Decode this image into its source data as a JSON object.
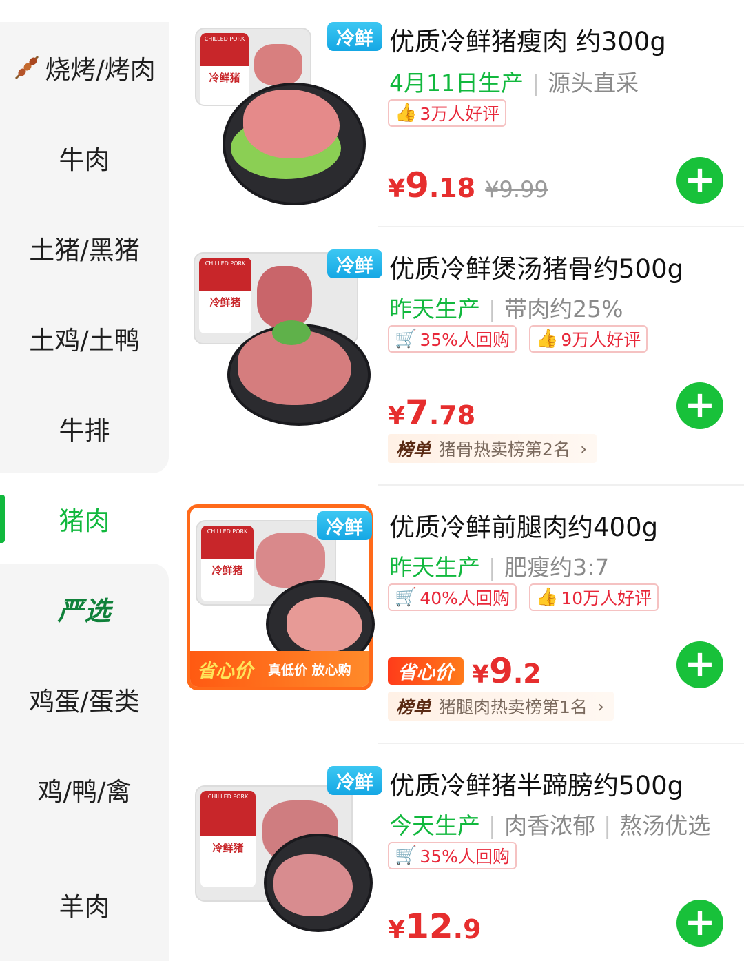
{
  "sidebar": {
    "items": [
      {
        "label": "烧烤/烤肉",
        "icon": "skewer-icon"
      },
      {
        "label": "牛肉"
      },
      {
        "label": "土猪/黑猪"
      },
      {
        "label": "土鸡/土鸭"
      },
      {
        "label": "牛排"
      },
      {
        "label": "猪肉",
        "active": true
      },
      {
        "label": "严选"
      },
      {
        "label": "鸡蛋/蛋类"
      },
      {
        "label": "鸡/鸭/禽"
      },
      {
        "label": "羊肉"
      }
    ]
  },
  "products": [
    {
      "badge": "冷鲜",
      "title": "优质冷鲜猪瘦肉 约300g",
      "production": "4月11日生产",
      "note1": "源头直采",
      "note2": "",
      "tags": [
        {
          "icon": "thumbs-up-icon",
          "text": "3万人好评"
        }
      ],
      "price_currency": "¥",
      "price_int": "9",
      "price_dec": ".18",
      "original_price": "¥9.99",
      "add_label": "+"
    },
    {
      "badge": "冷鲜",
      "title": "优质冷鲜煲汤猪骨约500g",
      "production": "昨天生产",
      "note1": "带肉约25%",
      "note2": "",
      "tags": [
        {
          "icon": "cart-icon",
          "text": "35%人回购"
        },
        {
          "icon": "thumbs-up-icon",
          "text": "9万人好评"
        }
      ],
      "price_currency": "¥",
      "price_int": "7",
      "price_dec": ".78",
      "rank_label": "榜单",
      "rank_text": "猪骨热卖榜第2名",
      "add_label": "+"
    },
    {
      "badge": "冷鲜",
      "promo_banner_main": "省心价",
      "promo_banner_sub": "真低价 放心购",
      "title": "优质冷鲜前腿肉约400g",
      "production": "昨天生产",
      "note1": "肥瘦约3:7",
      "note2": "",
      "tags": [
        {
          "icon": "cart-icon",
          "text": "40%人回购"
        },
        {
          "icon": "thumbs-up-icon",
          "text": "10万人好评"
        }
      ],
      "promo_price_label": "省心价",
      "price_currency": "¥",
      "price_int": "9",
      "price_dec": ".2",
      "rank_label": "榜单",
      "rank_text": "猪腿肉热卖榜第1名",
      "add_label": "+"
    },
    {
      "badge": "冷鲜",
      "title": "优质冷鲜猪半蹄膀约500g",
      "production": "今天生产",
      "note1": "肉香浓郁",
      "note2": "熬汤优选",
      "tags": [
        {
          "icon": "cart-icon",
          "text": "35%人回购"
        }
      ],
      "price_currency": "¥",
      "price_int": "12",
      "price_dec": ".9",
      "add_label": "+"
    }
  ],
  "package_label": "冷鲜猪",
  "package_brand": "CHILLED PORK",
  "rank_chevron": "›",
  "colors": {
    "accent_green": "#11b83d",
    "price_red": "#e62e2e",
    "badge_blue": "#15a7e4",
    "promo_orange": "#ff6a1a"
  }
}
